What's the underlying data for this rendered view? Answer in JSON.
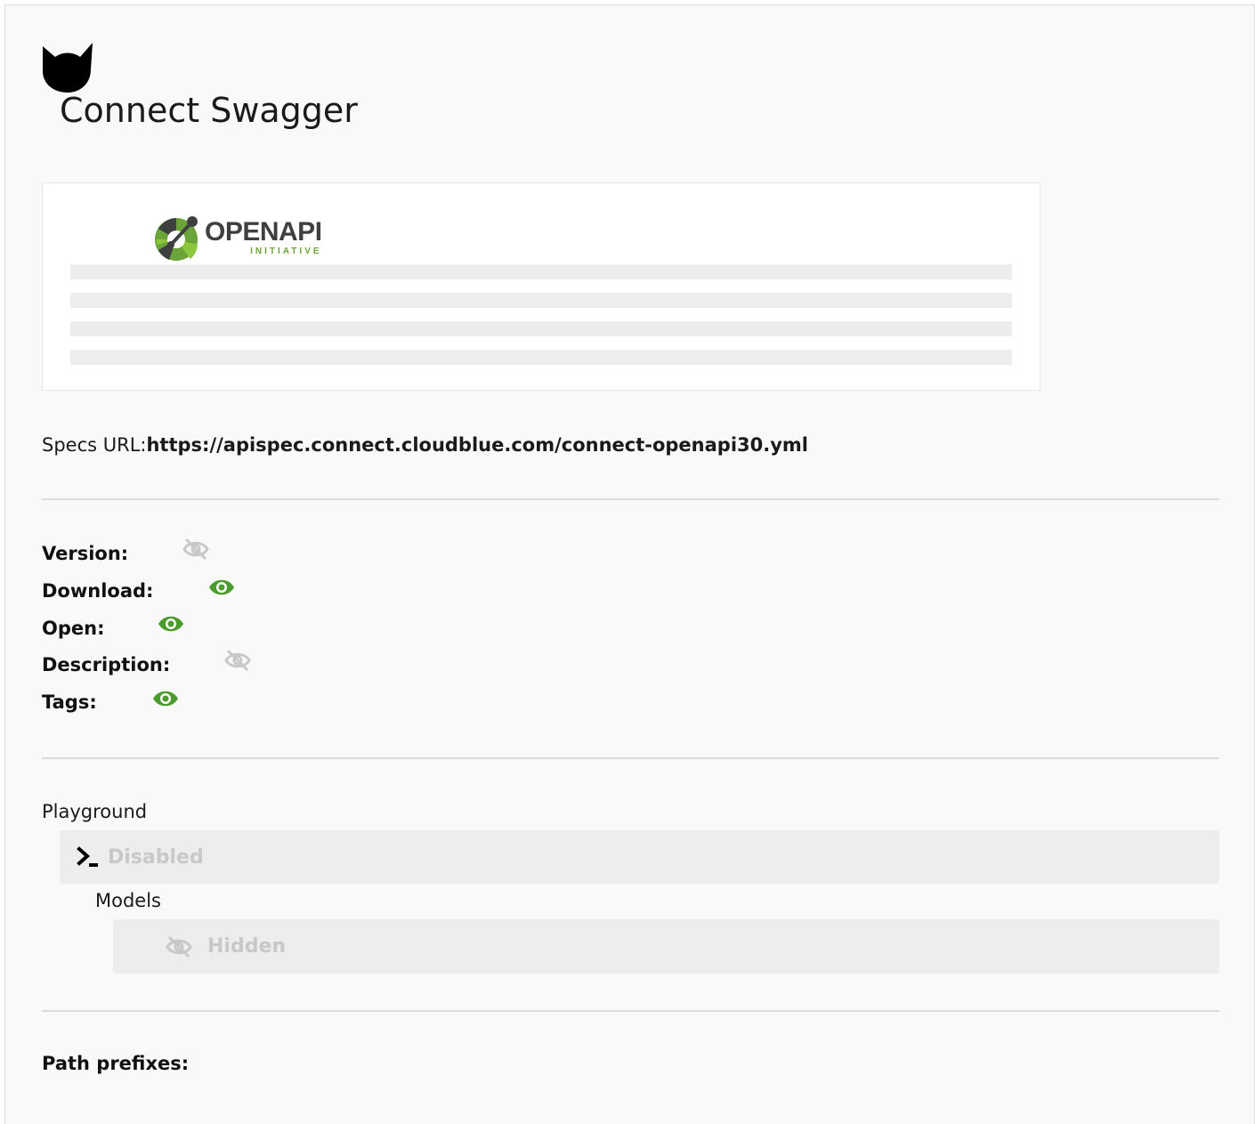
{
  "page": {
    "title": "Connect Swagger",
    "logo_icon": "cat-head-icon"
  },
  "card": {
    "logo": {
      "word": "OPENAPI",
      "sub": "INITIATIVE",
      "colors": {
        "dark": "#3e4040",
        "green": "#6ba539",
        "light_green": "#8cc63f"
      }
    },
    "placeholder_lines": 4
  },
  "specs": {
    "label": "Specs URL:",
    "url": "https://apispec.connect.cloudblue.com/connect-openapi30.yml"
  },
  "properties": [
    {
      "label": "Version:",
      "visible": false,
      "icon": "eye-slash-icon"
    },
    {
      "label": "Download:",
      "visible": true,
      "icon": "eye-icon"
    },
    {
      "label": "Open:",
      "visible": true,
      "icon": "eye-icon"
    },
    {
      "label": "Description:",
      "visible": false,
      "icon": "eye-slash-icon"
    },
    {
      "label": "Tags:",
      "visible": true,
      "icon": "eye-icon"
    }
  ],
  "playground": {
    "label": "Playground",
    "status": "Disabled",
    "icon": "terminal-icon"
  },
  "models": {
    "label": "Models",
    "status": "Hidden",
    "icon": "eye-slash-icon"
  },
  "path_prefixes": {
    "label": "Path prefixes:"
  },
  "colors": {
    "eye_visible": "#4a9c2d",
    "eye_hidden": "#c8c8c8",
    "background": "#f9f9f9",
    "box": "#ededed"
  }
}
